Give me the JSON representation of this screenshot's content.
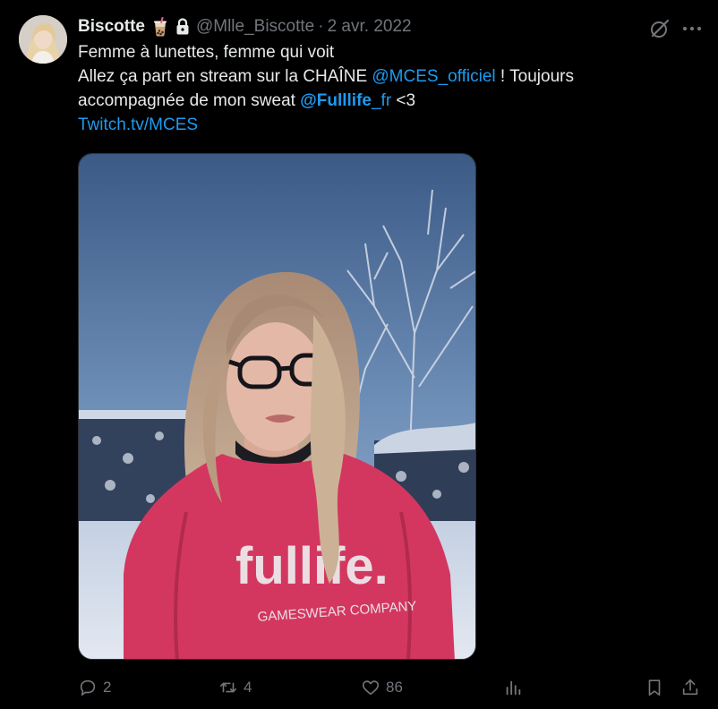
{
  "author": {
    "display_name": "Biscotte",
    "handle": "@Mlle_Biscotte",
    "date": "2 avr. 2022",
    "separator": "·",
    "badges": [
      "bubble-tea-emoji",
      "lock-icon"
    ]
  },
  "tweet": {
    "line1": "Femme à lunettes, femme qui voit",
    "line2_prefix": "Allez ça part en stream sur la CHAÎNE ",
    "line2_mention": "@MCES_officiel",
    "line2_suffix": " ! Toujours",
    "line3_prefix": "accompagnée de mon sweat ",
    "line3_mention_bold": "@Fulllife",
    "line3_mention_rest": "_fr",
    "line3_suffix": " <3",
    "link": "Twitch.tv/MCES"
  },
  "media": {
    "sweater_brand": "fullife.",
    "sweater_tagline": "GAMESWEAR COMPANY"
  },
  "actions": {
    "reply_count": "2",
    "retweet_count": "4",
    "like_count": "86"
  },
  "colors": {
    "background": "#000000",
    "text": "#e7e9ea",
    "secondary": "#71767b",
    "link": "#1d9bf0"
  }
}
